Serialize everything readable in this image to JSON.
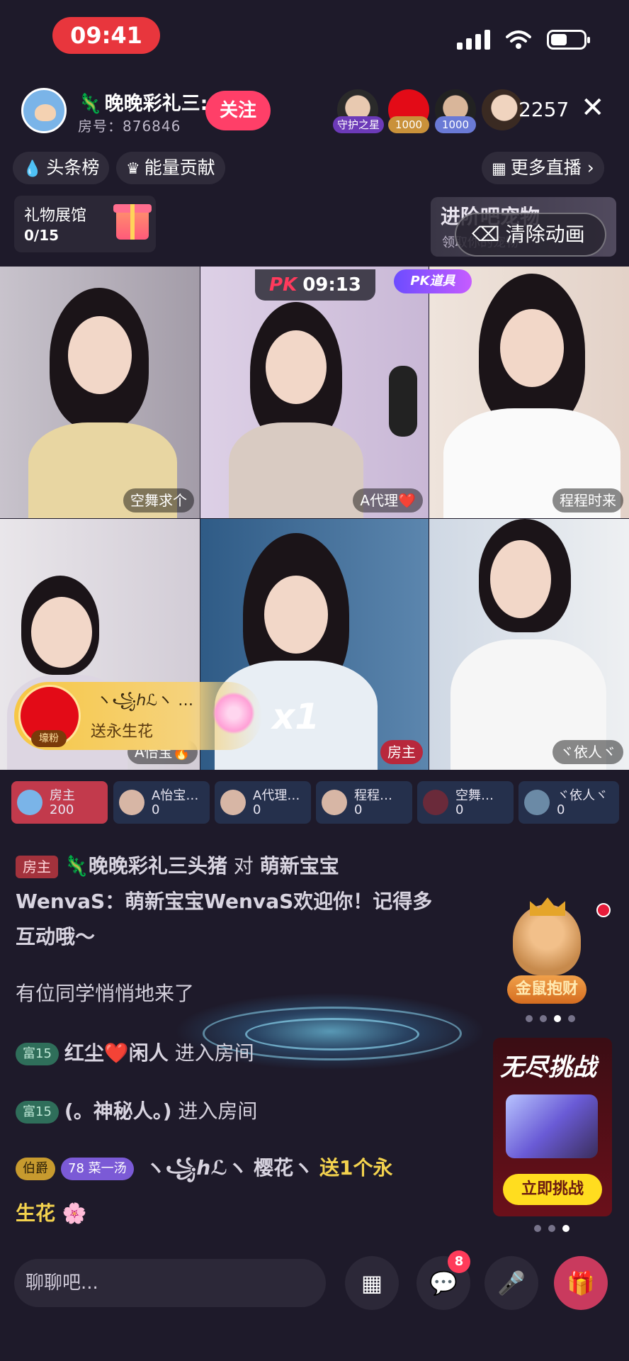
{
  "status": {
    "time": "09:41"
  },
  "host": {
    "name": "晚晚彩礼三:",
    "room_label": "房号：876846",
    "follow_label": "关注"
  },
  "guards": [
    {
      "tag": "守护之星"
    },
    {
      "tag": "1000"
    },
    {
      "tag": "1000"
    }
  ],
  "viewer_count": "2257",
  "chips": {
    "headline": "头条榜",
    "energy": "能量贡献",
    "more_live": "更多直播"
  },
  "gift_hall": {
    "title": "礼物展馆",
    "count": "0/15"
  },
  "promo": {
    "title": "进阶吧宠物",
    "subtitle": "领取你的宠物"
  },
  "clear_animation": "清除动画",
  "pk": {
    "logo": "PK",
    "time": "09:13",
    "tool_label": "PK道具"
  },
  "tiles": [
    {
      "label": "空舞求个"
    },
    {
      "label": "A代理❤️"
    },
    {
      "label": "程程时来"
    },
    {
      "label": "A怡宝🔥"
    },
    {
      "label": "房主"
    },
    {
      "label": "ヾ依人ヾ"
    }
  ],
  "gift_notice": {
    "tag": "壕粉",
    "user": "ヽ꧁ℎℒヽ …",
    "action": "送永生花",
    "count": "x1"
  },
  "scores": [
    {
      "name": "房主",
      "score": "200"
    },
    {
      "name": "A怡宝…",
      "score": "0"
    },
    {
      "name": "A代理…",
      "score": "0"
    },
    {
      "name": "程程…",
      "score": "0"
    },
    {
      "name": "空舞…",
      "score": "0"
    },
    {
      "name": "ヾ依人ヾ",
      "score": "0"
    }
  ],
  "chat": {
    "l1_badge": "房主",
    "l1_from": "晚晚彩礼三头猪",
    "l1_mid": "对",
    "l1_to": "萌新宝宝",
    "l2_user": "WenvaS",
    "l2_text": "：萌新宝宝WenvaS欢迎你！记得多",
    "l3_text": "互动哦～",
    "l4_text": "有位同学悄悄地来了",
    "l5_badge": "富15",
    "l5_user": "红尘❤️闲人",
    "l5_text": "进入房间",
    "l6_badge": "富15",
    "l6_user": "(。神秘人。)",
    "l6_text": "进入房间",
    "l7_noble": "伯爵",
    "l7_fans_level": "78",
    "l7_fans_name": "菜一汤",
    "l7_user": "ヽ꧁ℎℒヽ",
    "l7_user2": "樱花ヽ",
    "l7_text": "送1个永",
    "l8_text": "生花"
  },
  "widgets": {
    "mouse_label": "金鼠抱财",
    "challenge_title": "无尽挑战",
    "challenge_button": "立即挑战"
  },
  "bottom": {
    "input_placeholder": "聊聊吧...",
    "msg_count": "8"
  }
}
